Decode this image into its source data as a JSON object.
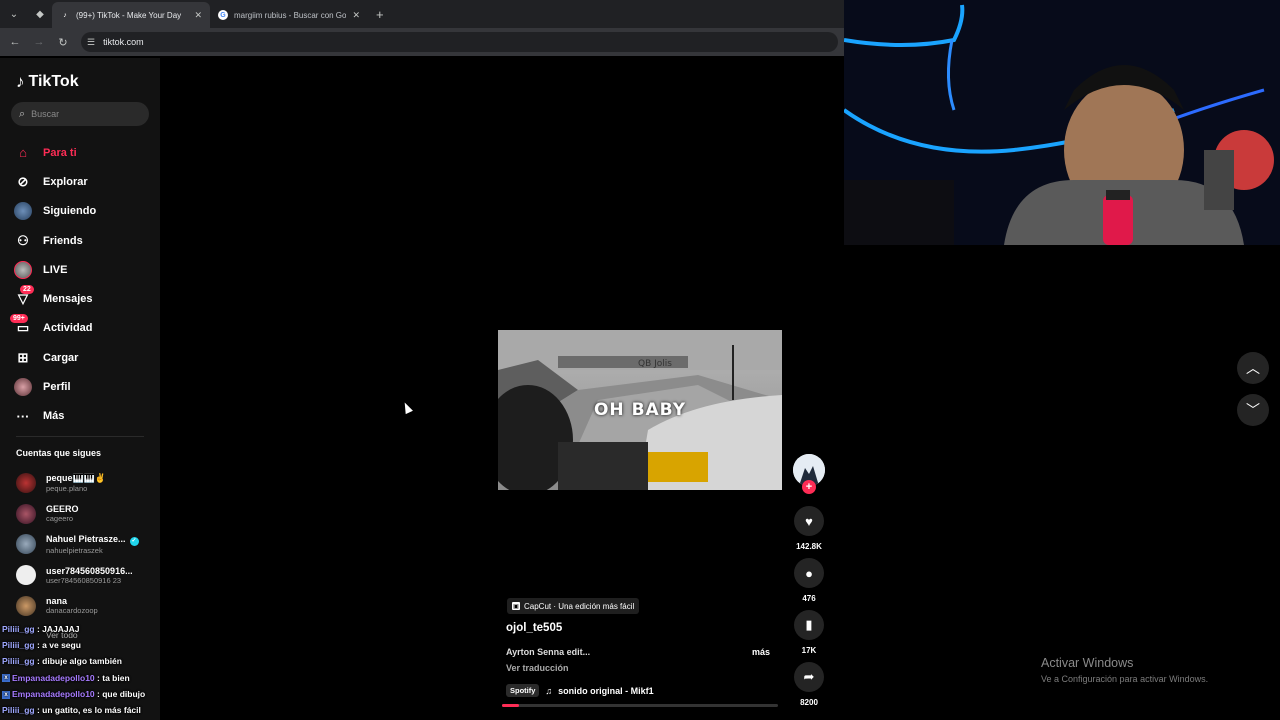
{
  "browser": {
    "tabs": [
      {
        "label": "(99+) TikTok - Make Your Day",
        "active": true,
        "icon": "tiktok-icon"
      },
      {
        "label": "margiim rubius - Buscar con Go",
        "active": false,
        "icon": "google-icon"
      }
    ],
    "url": "tiktok.com"
  },
  "sidebar": {
    "brand": "TikTok",
    "search_placeholder": "Buscar",
    "menu": [
      {
        "label": "Para ti",
        "icon": "home-icon",
        "active": true
      },
      {
        "label": "Explorar",
        "icon": "compass-icon"
      },
      {
        "label": "Siguiendo",
        "icon": "following-avatar-icon"
      },
      {
        "label": "Friends",
        "icon": "friends-icon"
      },
      {
        "label": "LIVE",
        "icon": "live-avatar-icon"
      },
      {
        "label": "Mensajes",
        "icon": "message-icon",
        "badge": "22"
      },
      {
        "label": "Actividad",
        "icon": "activity-icon",
        "badge": "99+"
      },
      {
        "label": "Cargar",
        "icon": "upload-icon"
      },
      {
        "label": "Perfil",
        "icon": "profile-avatar-icon"
      },
      {
        "label": "Más",
        "icon": "more-icon"
      }
    ],
    "following_title": "Cuentas que sigues",
    "following": [
      {
        "name": "peque🎹🎹✌",
        "handle": "peque.plano",
        "verified": false
      },
      {
        "name": "GEERO",
        "handle": "cageero",
        "verified": false
      },
      {
        "name": "Nahuel Pietrasze...",
        "handle": "nahuelpietraszek",
        "verified": true
      },
      {
        "name": "user784560850916...",
        "handle": "user784560850916 23",
        "verified": false
      },
      {
        "name": "nana",
        "handle": "danacardozoop",
        "verified": false
      }
    ],
    "see_all": "Ver todo"
  },
  "chat": [
    {
      "user": "Piliii_gg",
      "msg": ": JAJAJAJ",
      "badge": false
    },
    {
      "user": "Piliii_gg",
      "msg": ": a ve segu",
      "badge": false
    },
    {
      "user": "Piliii_gg",
      "msg": ": dibuje algo también",
      "badge": false
    },
    {
      "user": "Empanadadepollo10",
      "msg": ": ta bien",
      "badge": true
    },
    {
      "user": "Empanadadepollo10",
      "msg": ": que dibujo",
      "badge": true
    },
    {
      "user": "Piliii_gg",
      "msg": ": un gatito, es lo más fácil",
      "badge": false
    }
  ],
  "video": {
    "caption": "OH BABY",
    "capcut_label": "CapCut · Una edición más fácil",
    "author": "ojol_te505",
    "description": "Ayrton Senna edit...",
    "more": "más",
    "translate": "Ver traducción",
    "music_badge": "Spotify",
    "music": "sonido original - Mikf1",
    "progress": 0.06
  },
  "actions": {
    "likes": "142.8K",
    "comments": "476",
    "saves": "17K",
    "shares": "8200"
  },
  "windows": {
    "activate_title": "Activar Windows",
    "activate_sub": "Ve a Configuración para activar Windows."
  },
  "colors": {
    "accent": "#fe2c55",
    "sidebar_bg": "#121212",
    "chrome_bg": "#202124"
  }
}
